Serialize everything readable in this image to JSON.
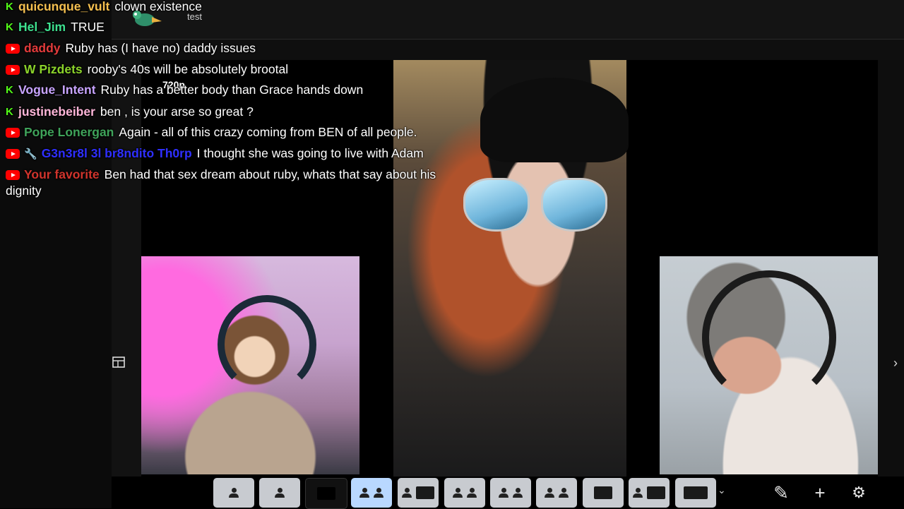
{
  "overlay": {
    "test_label": "test",
    "resolution_label": "720p"
  },
  "chat": {
    "messages": [
      {
        "badge": "kick",
        "name": "quicunque_vult",
        "name_color": "#f5c050",
        "text": "clown existence"
      },
      {
        "badge": "kick",
        "name": "Hel_Jim",
        "name_color": "#3ee08f",
        "text": "TRUE"
      },
      {
        "badge": "youtube",
        "name": "daddy",
        "name_color": "#e23b3b",
        "text": "Ruby has (I have no) daddy issues"
      },
      {
        "badge": "youtube",
        "name": "W Pizdets",
        "name_color": "#8bd32a",
        "text": "rooby's 40s will be absolutely brootal"
      },
      {
        "badge": "kick",
        "name": "Vogue_Intent",
        "name_color": "#c8a4ff",
        "text": "Ruby has a better body than Grace hands down"
      },
      {
        "badge": "kick",
        "name": "justinebeiber",
        "name_color": "#ffb6d9",
        "text": "ben , is your arse so great ?"
      },
      {
        "badge": "youtube",
        "name": "Pope Lonergan",
        "name_color": "#3fa35a",
        "text": "Again - all of this crazy coming from BEN of all people."
      },
      {
        "badge": "youtube",
        "extra_icon": "wrench-icon",
        "name": "G3n3r8l 3l br8ndito Th0rp",
        "name_color": "#2f2fff",
        "text": "I thought she was going to live with Adam"
      },
      {
        "badge": "youtube",
        "name": "Your favorite",
        "name_color": "#d0342c",
        "text": "Ben had that sex dream about ruby, whats that say about his",
        "continuation": "dignity"
      }
    ]
  },
  "toolbar": {
    "layouts": [
      "single-person",
      "single-person-alt",
      "screen-only",
      "two-up-active",
      "screen-with-person",
      "two-persons",
      "two-persons-split",
      "two-persons-boxed",
      "presenter",
      "person-and-screen",
      "screen-wide"
    ],
    "icons": [
      "pencil-icon",
      "plus-icon",
      "gear-icon"
    ]
  }
}
